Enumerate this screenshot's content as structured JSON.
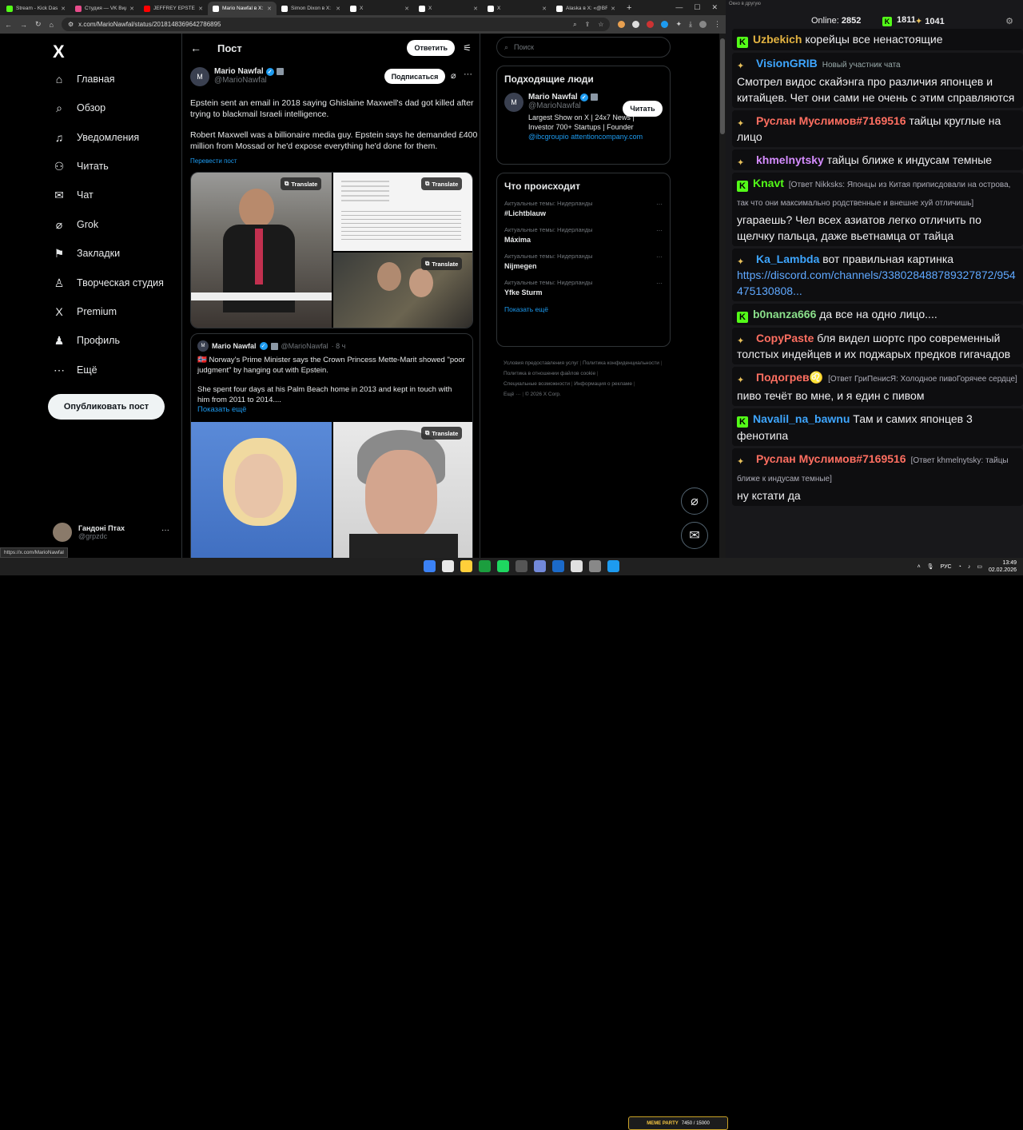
{
  "browser": {
    "tabs": [
      {
        "title": "Stream - Kick Dash",
        "color": "#53fc18",
        "active": false
      },
      {
        "title": "Студия — VK Виде",
        "color": "#e74c8b",
        "active": false
      },
      {
        "title": "JEFFREY EPSTEIN I.",
        "color": "#ff0000",
        "active": false
      },
      {
        "title": "Mario Nawfal в X: «",
        "color": "#ffffff",
        "active": true
      },
      {
        "title": "Simon Dixon в X: «",
        "color": "#ffffff",
        "active": false
      },
      {
        "title": "X",
        "color": "#ffffff",
        "active": false
      },
      {
        "title": "X",
        "color": "#ffffff",
        "active": false
      },
      {
        "title": "X",
        "color": "#ffffff",
        "active": false
      },
      {
        "title": "Alaska в X: «@BRI",
        "color": "#ffffff",
        "active": false
      }
    ],
    "url": "x.com/MarioNawfal/status/2018148369642786895",
    "status_url": "https://x.com/MarioNawfal"
  },
  "nav": {
    "logo": "X",
    "items": [
      {
        "label": "Главная",
        "icon": "⌂"
      },
      {
        "label": "Обзор",
        "icon": "⌕"
      },
      {
        "label": "Уведомления",
        "icon": "♫"
      },
      {
        "label": "Читать",
        "icon": "⚇"
      },
      {
        "label": "Чат",
        "icon": "✉"
      },
      {
        "label": "Grok",
        "icon": "⌀"
      },
      {
        "label": "Закладки",
        "icon": "⚑"
      },
      {
        "label": "Творческая студия",
        "icon": "♙"
      },
      {
        "label": "Premium",
        "icon": "X"
      },
      {
        "label": "Профиль",
        "icon": "♟"
      },
      {
        "label": "Ещё",
        "icon": "⋯"
      }
    ],
    "post_button": "Опубликовать пост",
    "account_name": "Гандоні Птах",
    "account_handle": "@grpzdc"
  },
  "post": {
    "header": "Пост",
    "reply_button": "Ответить",
    "author_name": "Mario Nawfal",
    "author_handle": "@MarioNawfal",
    "subscribe_button": "Подписаться",
    "text1": "Epstein sent an email in 2018 saying Ghislaine Maxwell's dad got killed after trying to blackmail Israeli intelligence.",
    "text2": "Robert Maxwell was a billionaire media guy. Epstein says he demanded £400 million from Mossad or he'd expose everything he'd done for them.",
    "translate_link": "Перевести пост",
    "translate_badge": "Translate",
    "quote": {
      "author_name": "Mario Nawfal",
      "author_handle": "@MarioNawfal",
      "time": "· 8 ч",
      "text1": "🇳🇴 Norway's Prime Minister says the Crown Princess Mette-Marit showed \"poor judgment\" by hanging out with Epstein.",
      "text2": "She spent four days at his Palm Beach home in 2013 and kept in touch with him from 2011 to 2014....",
      "more": "Показать ещё"
    }
  },
  "sidebar": {
    "search_placeholder": "Поиск",
    "who_to_follow_title": "Подходящие люди",
    "suggest_name": "Mario Nawfal",
    "suggest_handle": "@MarioNawfal",
    "follow_button": "Читать",
    "suggest_bio": "Largest Show on X | 24x7 News | Investor 700+ Startups | Founder",
    "suggest_link1": "@ibcgroupio",
    "suggest_link2": "attentioncompany.com",
    "trends_title": "Что происходит",
    "trends": [
      {
        "category": "Актуальные темы: Нидерланды",
        "name": "#Lichtblauw"
      },
      {
        "category": "Актуальные темы: Нидерланды",
        "name": "Máxima"
      },
      {
        "category": "Актуальные темы: Нидерланды",
        "name": "Nijmegen"
      },
      {
        "category": "Актуальные темы: Нидерланды",
        "name": "Yfke Sturm"
      }
    ],
    "show_more": "Показать ещё",
    "footer": [
      "Условия предоставления услуг",
      "Политика конфиденциальности",
      "Политика в отношении файлов cookie",
      "Специальные возможности",
      "Информация о рекламе",
      "Ещё ···",
      "© 2026 X Corp."
    ]
  },
  "chat": {
    "window_title": "Окно в другую",
    "online_label": "Online:",
    "online_count": "2852",
    "kick_count": "1811",
    "other_count": "1041",
    "messages": [
      {
        "badge": "K",
        "nick": "Uzbekich",
        "color": "#e3b341",
        "reply": "",
        "text": "корейцы все ненастоящие",
        "tag": ""
      },
      {
        "badge": "E",
        "nick": "VisionGRIB",
        "color": "#3ea6ff",
        "reply": "",
        "text": "Смотрел видос скайэнга про различия японцев и китайцев. Чет они сами не очень с этим справляются",
        "tag": "Новый участник чата"
      },
      {
        "badge": "E",
        "nick": "Руслан Муслимов#7169516",
        "color": "#ff6f61",
        "reply": "",
        "text": "тайцы круглые на лицо",
        "tag": ""
      },
      {
        "badge": "E",
        "nick": "khmelnytsky",
        "color": "#d58cff",
        "reply": "",
        "text": "тайцы ближе к индусам темные",
        "tag": ""
      },
      {
        "badge": "K",
        "nick": "Knavt",
        "color": "#53fc18",
        "reply": "[Ответ Nikksks: Японцы из Китая приписдовали на острова, так что они максимально родственные и внешне хуй отличишь]",
        "text": "угараешь? Чел всех азиатов легко отличить по щелчку пальца, даже вьетнамца от тайца",
        "tag": ""
      },
      {
        "badge": "E",
        "nick": "Ka_Lambda",
        "color": "#3ea6ff",
        "reply": "",
        "text": "вот правильная картинка",
        "link": "https://discord.com/channels/338028488789327872/954475130808...",
        "tag": ""
      },
      {
        "badge": "K",
        "nick": "b0nanza666",
        "color": "#8be08b",
        "reply": "",
        "text": "да все на одно лицо....",
        "tag": ""
      },
      {
        "badge": "E",
        "nick": "CopyPaste",
        "color": "#ff6f61",
        "reply": "",
        "text": "бля видел шортс про современный толстых индейцев и их поджарых предков гигачадов",
        "tag": ""
      },
      {
        "badge": "E",
        "nick": "Подогрев&#x264C;",
        "color": "#ff6f61",
        "reply": "[Ответ ГриПенисЯ: Холодное пивоГорячее сердце]",
        "text": "пиво течёт во мне, и я един с пивом",
        "tag": ""
      },
      {
        "badge": "K",
        "nick": "Navalil_na_bawnu",
        "color": "#3ea6ff",
        "reply": "",
        "text": "Там и самих японцев 3 фенотипа",
        "tag": ""
      },
      {
        "badge": "E",
        "nick": "Руслан Муслимов#7169516",
        "color": "#ff6f61",
        "reply": "[Ответ khmelnytsky: тайцы ближе к индусам темные]",
        "text": "ну кстати да",
        "tag": ""
      }
    ]
  },
  "taskbar": {
    "lang": "РУС",
    "time": "13:49",
    "date": "02.02.2026",
    "meme_label": "MEME PARTY",
    "meme_progress": "7450 / 15000"
  }
}
